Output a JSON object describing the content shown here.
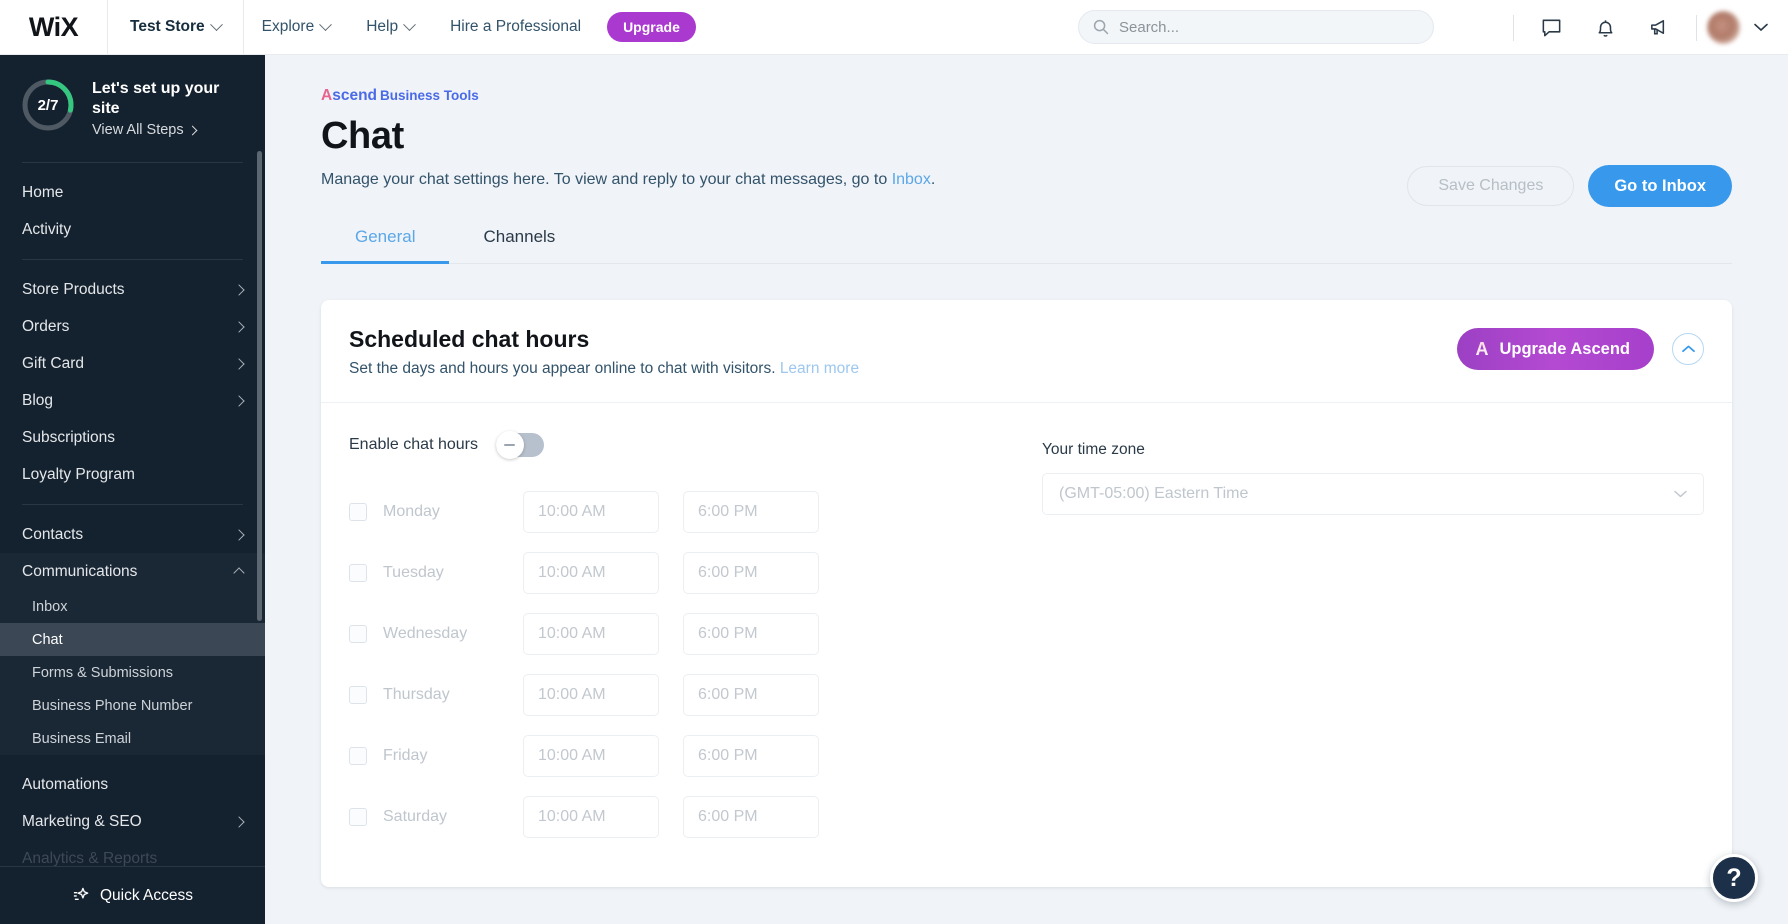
{
  "topbar": {
    "logo": "WiX",
    "site_name": "Test Store",
    "menu": [
      {
        "label": "Explore",
        "caret": true
      },
      {
        "label": "Help",
        "caret": true
      },
      {
        "label": "Hire a Professional",
        "caret": false
      }
    ],
    "upgrade_label": "Upgrade",
    "search_placeholder": "Search...",
    "icons": [
      "chat-bubble-icon",
      "bell-icon",
      "megaphone-icon"
    ]
  },
  "sidebar": {
    "setup": {
      "progress_text": "2/7",
      "progress_done": 2,
      "progress_total": 7,
      "title": "Let's set up your site",
      "link": "View All Steps"
    },
    "groups": [
      {
        "items": [
          {
            "label": "Home",
            "arrow": false
          },
          {
            "label": "Activity",
            "arrow": false
          }
        ]
      },
      {
        "items": [
          {
            "label": "Store Products",
            "arrow": true
          },
          {
            "label": "Orders",
            "arrow": true
          },
          {
            "label": "Gift Card",
            "arrow": true
          },
          {
            "label": "Blog",
            "arrow": true
          },
          {
            "label": "Subscriptions",
            "arrow": false
          },
          {
            "label": "Loyalty Program",
            "arrow": false
          }
        ]
      },
      {
        "items": [
          {
            "label": "Contacts",
            "arrow": true
          },
          {
            "label": "Communications",
            "arrow": true,
            "expanded": true,
            "children": [
              {
                "label": "Inbox",
                "active": false
              },
              {
                "label": "Chat",
                "active": true
              },
              {
                "label": "Forms & Submissions",
                "active": false
              },
              {
                "label": "Business Phone Number",
                "active": false
              },
              {
                "label": "Business Email",
                "active": false
              }
            ]
          },
          {
            "label": "Automations",
            "arrow": false
          },
          {
            "label": "Marketing & SEO",
            "arrow": true
          },
          {
            "label": "Analytics & Reports",
            "arrow": true,
            "faded": true
          }
        ]
      }
    ],
    "quick_access": "Quick Access"
  },
  "page": {
    "kicker_a": "A",
    "kicker_rest": "scend",
    "kicker_suffix": "Business Tools",
    "title": "Chat",
    "subtitle_before": "Manage your chat settings here. To view and reply to your chat messages, go to ",
    "subtitle_link": "Inbox",
    "subtitle_after": ".",
    "save_label": "Save Changes",
    "inbox_label": "Go to Inbox",
    "tabs": [
      {
        "label": "General",
        "active": true
      },
      {
        "label": "Channels",
        "active": false
      }
    ]
  },
  "card": {
    "title": "Scheduled chat hours",
    "subtitle_text": "Set the days and hours you appear online to chat with visitors. ",
    "subtitle_link": "Learn more",
    "upgrade_icon": "A",
    "upgrade_label": "Upgrade Ascend",
    "collapse_icon": "chevron-up-icon",
    "enable_label": "Enable chat hours",
    "enable_value": false,
    "days": [
      {
        "name": "Monday",
        "checked": false,
        "start": "10:00 AM",
        "end": "6:00 PM"
      },
      {
        "name": "Tuesday",
        "checked": false,
        "start": "10:00 AM",
        "end": "6:00 PM"
      },
      {
        "name": "Wednesday",
        "checked": false,
        "start": "10:00 AM",
        "end": "6:00 PM"
      },
      {
        "name": "Thursday",
        "checked": false,
        "start": "10:00 AM",
        "end": "6:00 PM"
      },
      {
        "name": "Friday",
        "checked": false,
        "start": "10:00 AM",
        "end": "6:00 PM"
      },
      {
        "name": "Saturday",
        "checked": false,
        "start": "10:00 AM",
        "end": "6:00 PM"
      }
    ],
    "timezone_label": "Your time zone",
    "timezone_value": "(GMT-05:00) Eastern Time"
  },
  "help_fab": "?",
  "colors": {
    "accent_blue": "#3899ec",
    "link_blue": "#5ba7e8",
    "sidebar_bg": "#14212e",
    "upgrade_purple": "#aa39cf",
    "ascend_gradient_start": "#9c40c4",
    "ring_green": "#35c77f",
    "page_bg": "#f0f3f7"
  }
}
